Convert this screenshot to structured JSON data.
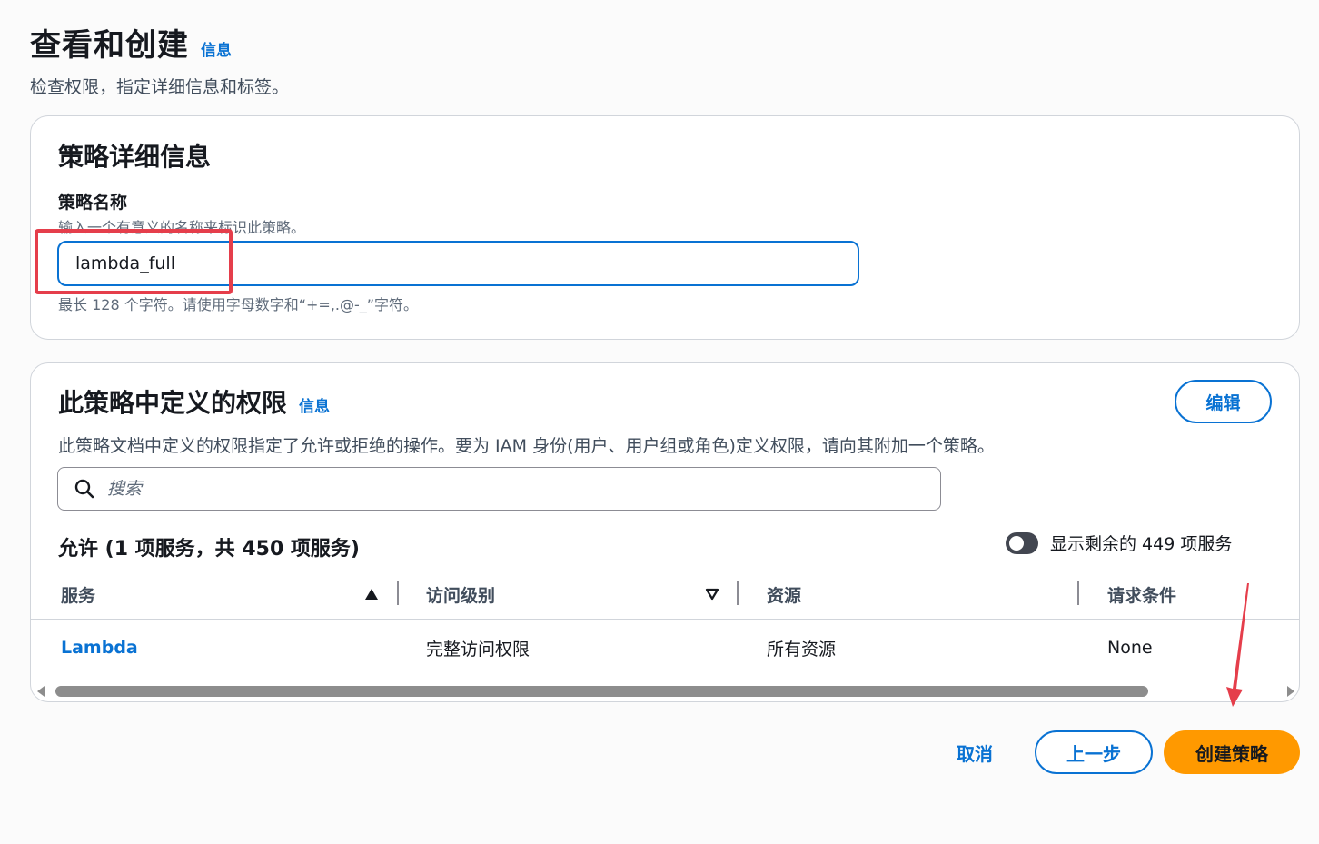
{
  "header": {
    "title": "查看和创建",
    "info_link": "信息",
    "subtitle": "检查权限，指定详细信息和标签。"
  },
  "policy_details": {
    "title": "策略详细信息",
    "name_label": "策略名称",
    "name_description": "输入一个有意义的名称来标识此策略。",
    "name_value": "lambda_full",
    "name_constraint": "最长 128 个字符。请使用字母数字和“+=,.@-_”字符。"
  },
  "permissions": {
    "title": "此策略中定义的权限",
    "info_link": "信息",
    "edit_button": "编辑",
    "description": "此策略文档中定义的权限指定了允许或拒绝的操作。要为 IAM 身份(用户、用户组或角色)定义权限，请向其附加一个策略。",
    "search_placeholder": "搜索",
    "allow_heading": "允许 (1 项服务，共 450 项服务)",
    "toggle_label": "显示剩余的 449 项服务",
    "columns": [
      "服务",
      "访问级别",
      "资源",
      "请求条件"
    ],
    "rows": [
      {
        "service": "Lambda",
        "access_level": "完整访问权限",
        "resource": "所有资源",
        "conditions": "None"
      }
    ]
  },
  "footer": {
    "cancel": "取消",
    "previous": "上一步",
    "create": "创建策略"
  },
  "colors": {
    "link_blue": "#0972d3",
    "primary_orange": "#ff9900",
    "annotation_red": "#e53e4b"
  }
}
